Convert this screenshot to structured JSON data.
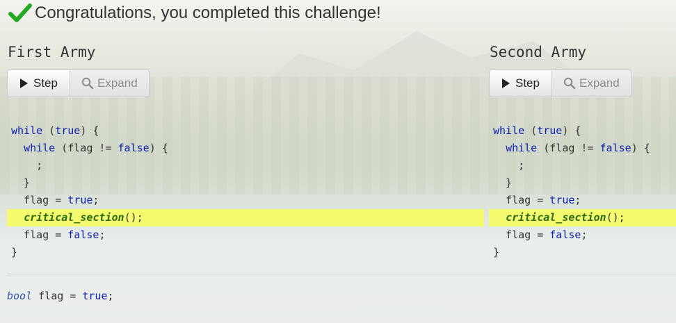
{
  "header": {
    "message": "Congratulations, you completed this challenge!",
    "icon": "check-icon",
    "icon_color": "#22aa22"
  },
  "armies": [
    {
      "title": "First Army",
      "step_label": "Step",
      "expand_label": "Expand",
      "highlight_line": 5
    },
    {
      "title": "Second Army",
      "step_label": "Step",
      "expand_label": "Expand",
      "highlight_line": 5
    }
  ],
  "code": {
    "l0_kw": "while",
    "l0_rest_a": " (",
    "l0_true": "true",
    "l0_rest_b": ") {",
    "l1_indent": "  ",
    "l1_kw": "while",
    "l1_rest_a": " (flag != ",
    "l1_false": "false",
    "l1_rest_b": ") {",
    "l2": "    ;",
    "l3": "  }",
    "l4_a": "  flag = ",
    "l4_true": "true",
    "l4_b": ";",
    "l5_indent": "  ",
    "l5_fn": "critical_section",
    "l5_rest": "();",
    "l6_a": "  flag = ",
    "l6_false": "false",
    "l6_b": ";",
    "l7": "}"
  },
  "shared": {
    "type": "bool",
    "decl": " flag = ",
    "value": "true",
    "end": ";"
  },
  "colors": {
    "highlight": "#f4fb6e",
    "keyword": "#0a1db0",
    "function": "#2c6b12"
  }
}
